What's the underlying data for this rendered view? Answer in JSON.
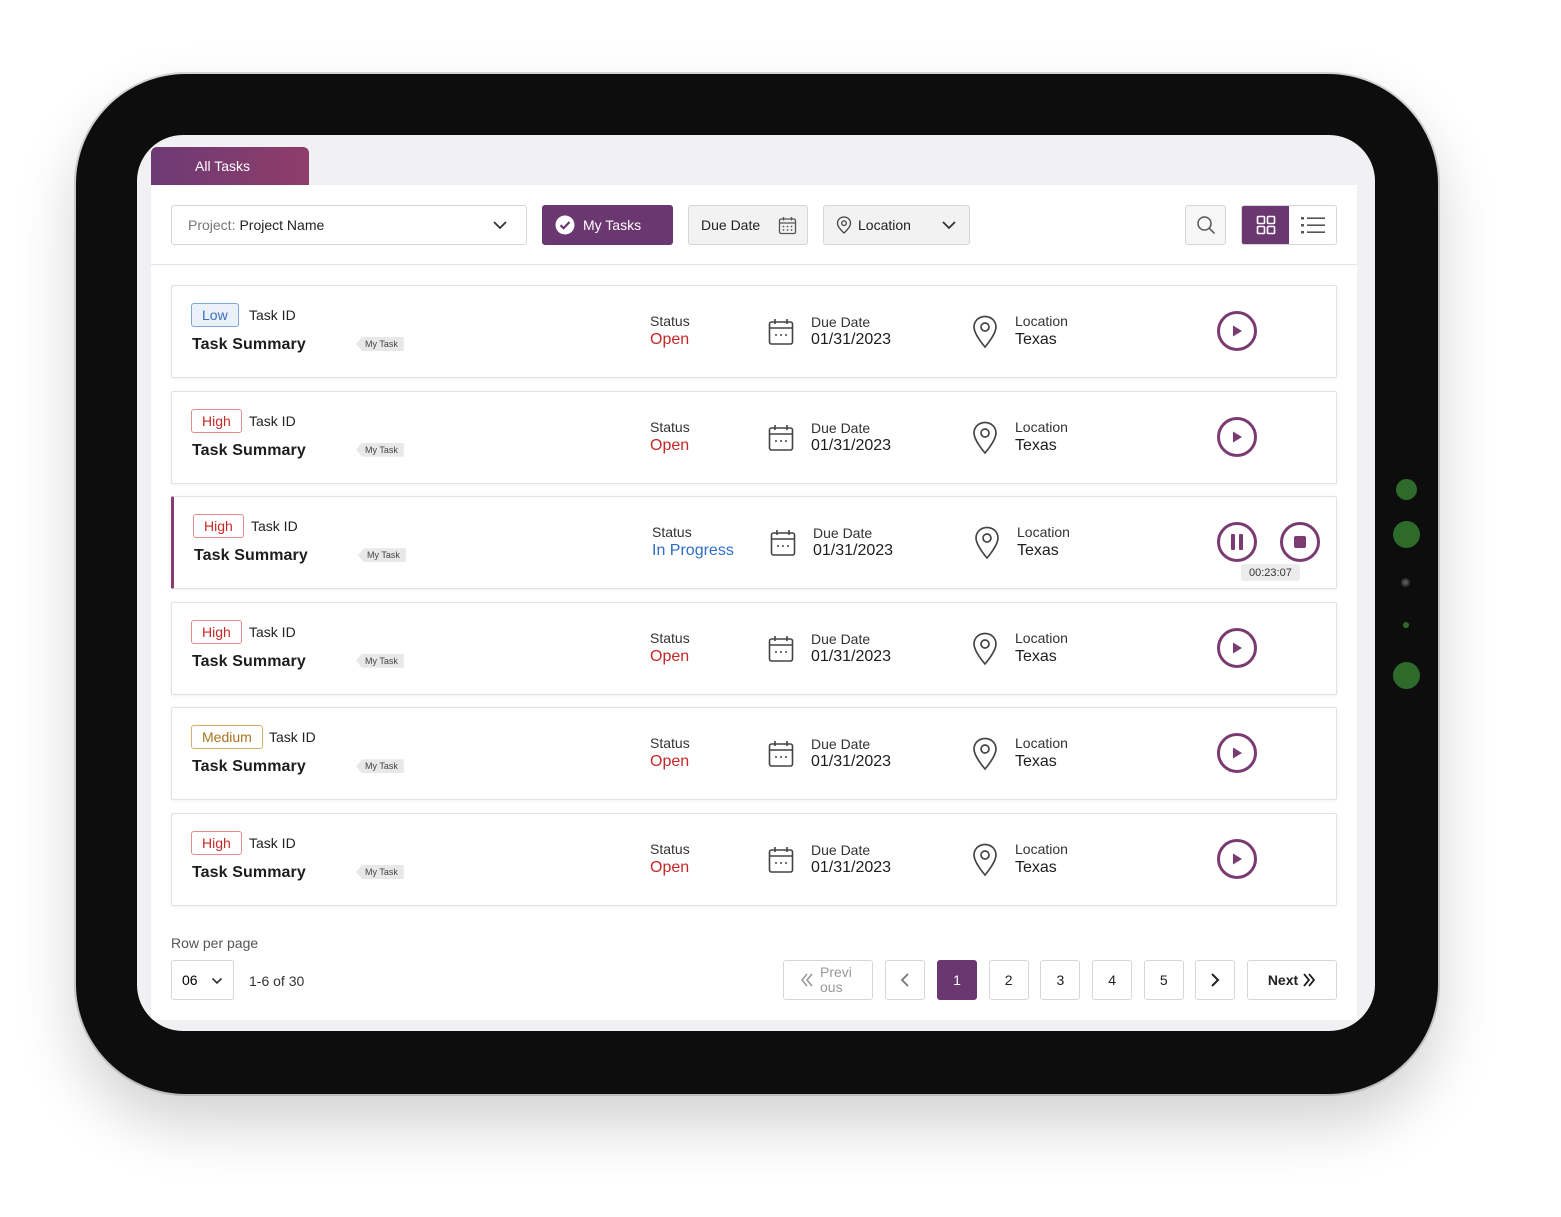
{
  "tabs": {
    "all_tasks": "All Tasks"
  },
  "toolbar": {
    "project_label": "Project:",
    "project_value": "Project Name",
    "my_tasks": "My Tasks",
    "due_date": "Due Date",
    "location": "Location"
  },
  "labels": {
    "task_id": "Task ID",
    "task_summary": "Task Summary",
    "my_task_tag": "My Task",
    "status": "Status",
    "due_date": "Due Date",
    "location": "Location"
  },
  "tasks": [
    {
      "priority": "Low",
      "status": "Open",
      "due": "01/31/2023",
      "location": "Texas",
      "state": "idle"
    },
    {
      "priority": "High",
      "status": "Open",
      "due": "01/31/2023",
      "location": "Texas",
      "state": "idle"
    },
    {
      "priority": "High",
      "status": "In Progress",
      "due": "01/31/2023",
      "location": "Texas",
      "state": "running",
      "timer": "00:23:07"
    },
    {
      "priority": "High",
      "status": "Open",
      "due": "01/31/2023",
      "location": "Texas",
      "state": "idle"
    },
    {
      "priority": "Medium",
      "status": "Open",
      "due": "01/31/2023",
      "location": "Texas",
      "state": "idle"
    },
    {
      "priority": "High",
      "status": "Open",
      "due": "01/31/2023",
      "location": "Texas",
      "state": "idle"
    }
  ],
  "pagination": {
    "rows_per_page_label": "Row per page",
    "rows_per_page": "06",
    "range": "1-6 of 30",
    "previous": "Previ ous",
    "pages": [
      "1",
      "2",
      "3",
      "4",
      "5"
    ],
    "current": "1",
    "next": "Next"
  },
  "colors": {
    "accent": "#6b3770",
    "open": "#c62828",
    "in_progress": "#2f6cc8",
    "device_dots": "#2e6b2a"
  }
}
